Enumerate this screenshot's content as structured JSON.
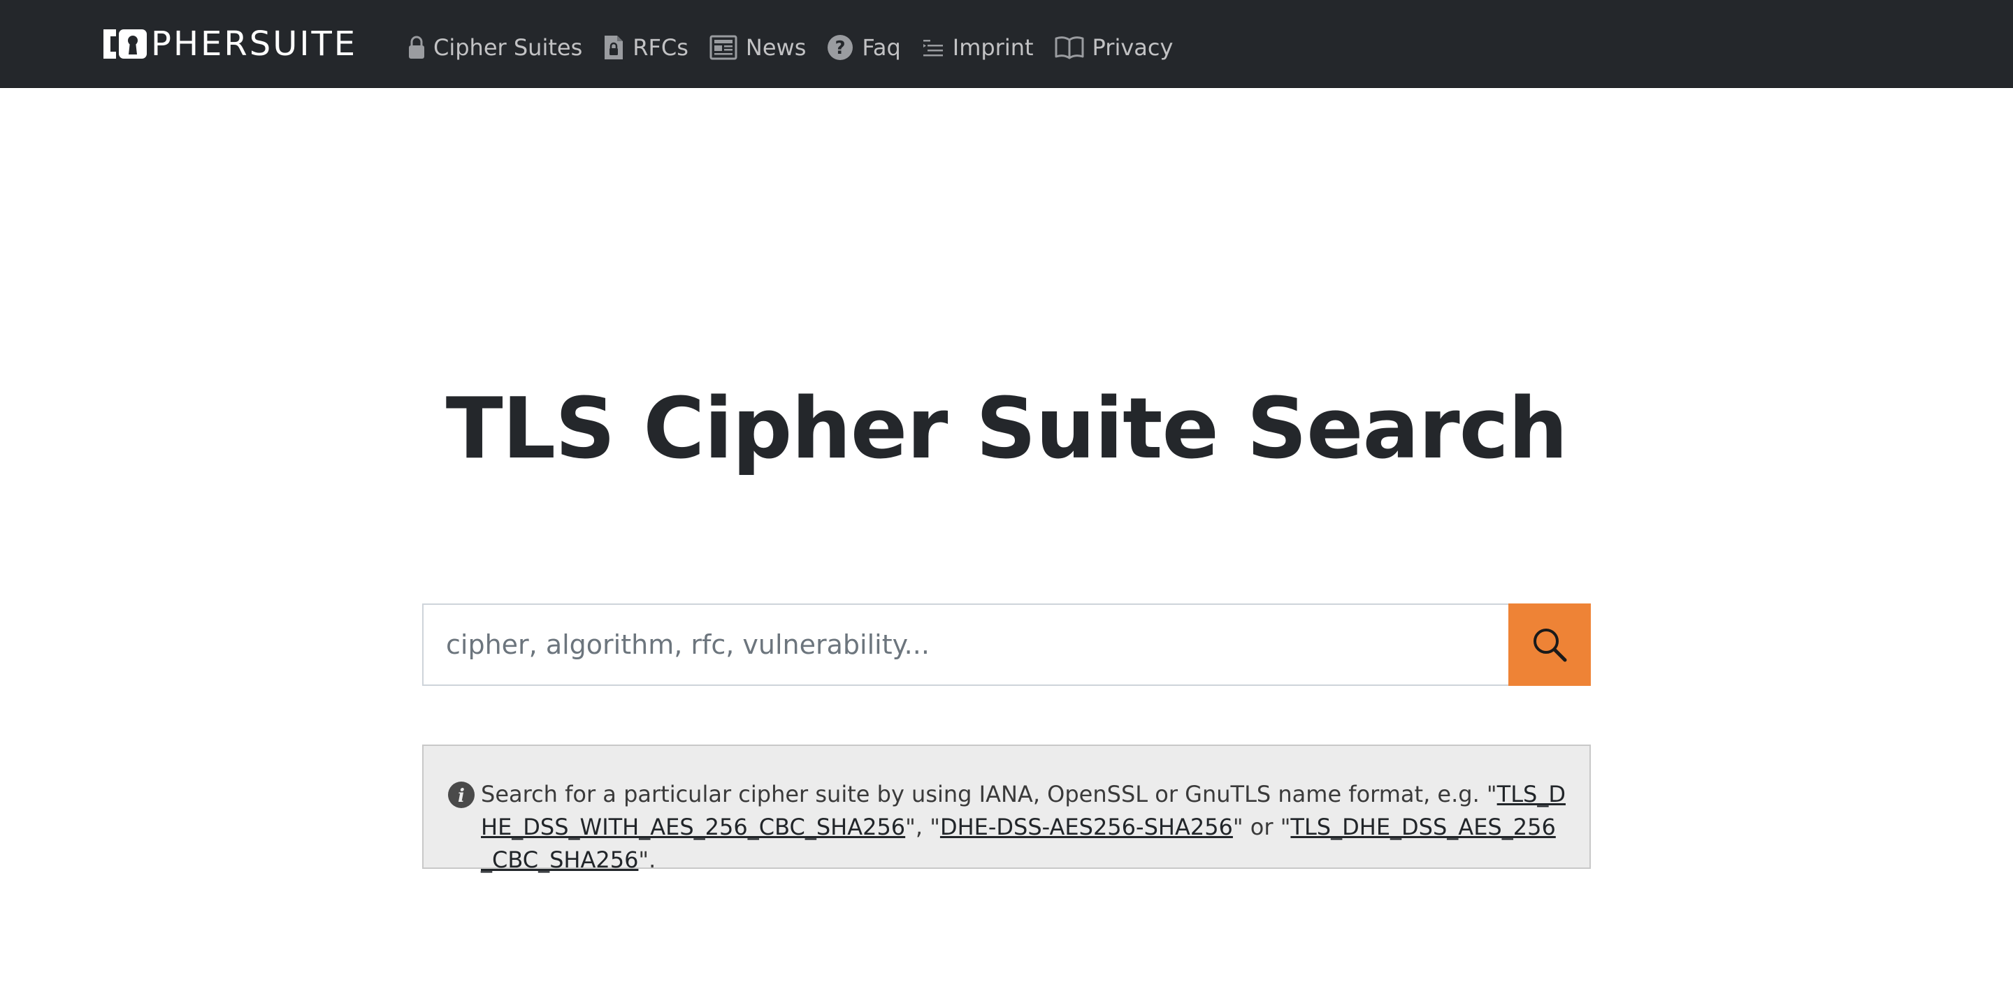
{
  "navbar": {
    "brand_text": "PHERSUITE",
    "items": [
      {
        "label": "Cipher Suites",
        "icon": "lock-icon"
      },
      {
        "label": "RFCs",
        "icon": "document-lock-icon"
      },
      {
        "label": "News",
        "icon": "newspaper-icon"
      },
      {
        "label": "Faq",
        "icon": "question-circle-icon"
      },
      {
        "label": "Imprint",
        "icon": "list-lines-icon"
      },
      {
        "label": "Privacy",
        "icon": "open-book-icon"
      }
    ]
  },
  "hero": {
    "title": "TLS Cipher Suite Search"
  },
  "search": {
    "placeholder": "cipher, algorithm, rfc, vulnerability...",
    "value": "",
    "button_icon": "search-icon",
    "button_color": "#ee8336"
  },
  "info": {
    "icon": "info-icon",
    "intro": "Search for a particular cipher suite by using IANA, OpenSSL or GnuTLS name format, e.g. \"",
    "example_iana": "TLS_DHE_DSS_WITH_AES_256_CBC_SHA256",
    "sep1": "\", \"",
    "example_openssl": "DHE-DSS-AES256-SHA256",
    "sep2": "\" or \"",
    "example_gnutls": "TLS_DHE_DSS_AES_256_CBC_SHA256",
    "outro": "\"."
  },
  "colors": {
    "navbar_bg": "#24272b",
    "accent": "#ee8336",
    "info_bg": "#ececec"
  }
}
